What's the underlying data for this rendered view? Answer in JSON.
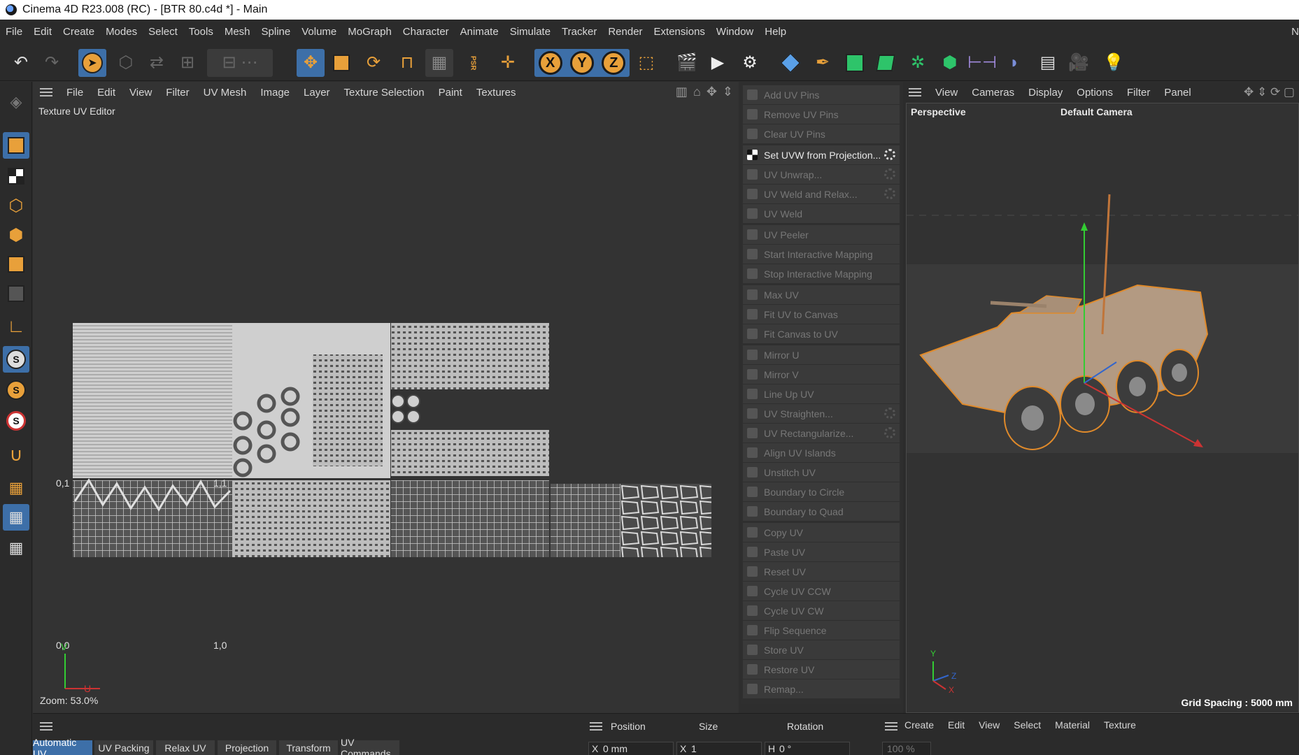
{
  "window": {
    "title": "Cinema 4D R23.008 (RC) - [BTR 80.c4d *] - Main"
  },
  "menubar": {
    "items": [
      "File",
      "Edit",
      "Create",
      "Modes",
      "Select",
      "Tools",
      "Mesh",
      "Spline",
      "Volume",
      "MoGraph",
      "Character",
      "Animate",
      "Simulate",
      "Tracker",
      "Render",
      "Extensions",
      "Window",
      "Help"
    ],
    "overflow": "N"
  },
  "toolbar": {
    "axis_x": "X",
    "axis_y": "Y",
    "axis_z": "Z",
    "psr": "PSR",
    "icons": [
      "undo-icon",
      "redo-icon",
      "select-icon",
      "move-icon",
      "scale-icon",
      "rotate-icon",
      "snap-icon",
      "axis-x-icon",
      "axis-y-icon",
      "axis-z-icon",
      "coordinate-system-icon",
      "render-region-icon",
      "render-view-icon",
      "render-settings-icon",
      "cube-icon",
      "pen-icon",
      "subdivide-icon",
      "extrude-icon",
      "mograph-icon",
      "cloner-icon",
      "deformer-icon",
      "field-icon",
      "floor-icon",
      "camera-icon",
      "light-icon"
    ]
  },
  "uv_editor": {
    "menu": [
      "File",
      "Edit",
      "View",
      "Filter",
      "UV Mesh",
      "Image",
      "Layer",
      "Texture Selection",
      "Paint",
      "Textures"
    ],
    "title": "Texture UV Editor",
    "labels": {
      "v01": "0,1",
      "u11": "1,1",
      "origin": "0,0",
      "u10": "1,0",
      "axis_v": "V",
      "axis_u": "U"
    },
    "zoom": "Zoom: 53.0%"
  },
  "uv_commands": [
    {
      "label": "Add UV Pins",
      "enabled": false
    },
    {
      "label": "Remove UV Pins",
      "enabled": false
    },
    {
      "label": "Clear UV Pins",
      "enabled": false
    },
    {
      "label": "Set UVW from Projection...",
      "enabled": true,
      "gear": true
    },
    {
      "label": "UV Unwrap...",
      "enabled": false,
      "gear": true
    },
    {
      "label": "UV Weld and Relax...",
      "enabled": false,
      "gear": true
    },
    {
      "label": "UV Weld",
      "enabled": false
    },
    {
      "label": "UV Peeler",
      "enabled": false
    },
    {
      "label": "Start Interactive Mapping",
      "enabled": false
    },
    {
      "label": "Stop Interactive Mapping",
      "enabled": false
    },
    {
      "label": "Max UV",
      "enabled": false
    },
    {
      "label": "Fit UV to Canvas",
      "enabled": false
    },
    {
      "label": "Fit Canvas to UV",
      "enabled": false
    },
    {
      "label": "Mirror U",
      "enabled": false
    },
    {
      "label": "Mirror V",
      "enabled": false
    },
    {
      "label": "Line Up UV",
      "enabled": false
    },
    {
      "label": "UV Straighten...",
      "enabled": false,
      "gear": true
    },
    {
      "label": "UV Rectangularize...",
      "enabled": false,
      "gear": true
    },
    {
      "label": "Align UV Islands",
      "enabled": false
    },
    {
      "label": "Unstitch UV",
      "enabled": false
    },
    {
      "label": "Boundary to Circle",
      "enabled": false
    },
    {
      "label": "Boundary to Quad",
      "enabled": false
    },
    {
      "label": "Copy UV",
      "enabled": false
    },
    {
      "label": "Paste UV",
      "enabled": false
    },
    {
      "label": "Reset UV",
      "enabled": false
    },
    {
      "label": "Cycle UV CCW",
      "enabled": false
    },
    {
      "label": "Cycle UV CW",
      "enabled": false
    },
    {
      "label": "Flip Sequence",
      "enabled": false
    },
    {
      "label": "Store UV",
      "enabled": false
    },
    {
      "label": "Restore UV",
      "enabled": false
    },
    {
      "label": "Remap...",
      "enabled": false
    }
  ],
  "viewport": {
    "menu": [
      "View",
      "Cameras",
      "Display",
      "Options",
      "Filter",
      "Panel"
    ],
    "label": "Perspective",
    "camera": "Default Camera",
    "grid_spacing": "Grid Spacing : 5000 mm",
    "axis_y": "Y",
    "axis_z": "Z",
    "axis_x": "X"
  },
  "bottom": {
    "uv_tabs": [
      "Automatic UV",
      "UV Packing",
      "Relax UV",
      "Projection",
      "Transform",
      "UV Commands"
    ],
    "active_tab": "Automatic UV",
    "coord_headers": {
      "position": "Position",
      "size": "Size",
      "rotation": "Rotation"
    },
    "fields": {
      "x_label": "X",
      "x_value": "0 mm",
      "sx_label": "X",
      "sx_value": "1",
      "h_label": "H",
      "h_value": "0 °"
    },
    "material_menu": [
      "Create",
      "Edit",
      "View",
      "Select",
      "Material",
      "Texture"
    ],
    "zoom_value": "100 %"
  },
  "colors": {
    "accent": "#3d6fa8",
    "axis_orange": "#e8a03a",
    "panel": "#333333"
  }
}
